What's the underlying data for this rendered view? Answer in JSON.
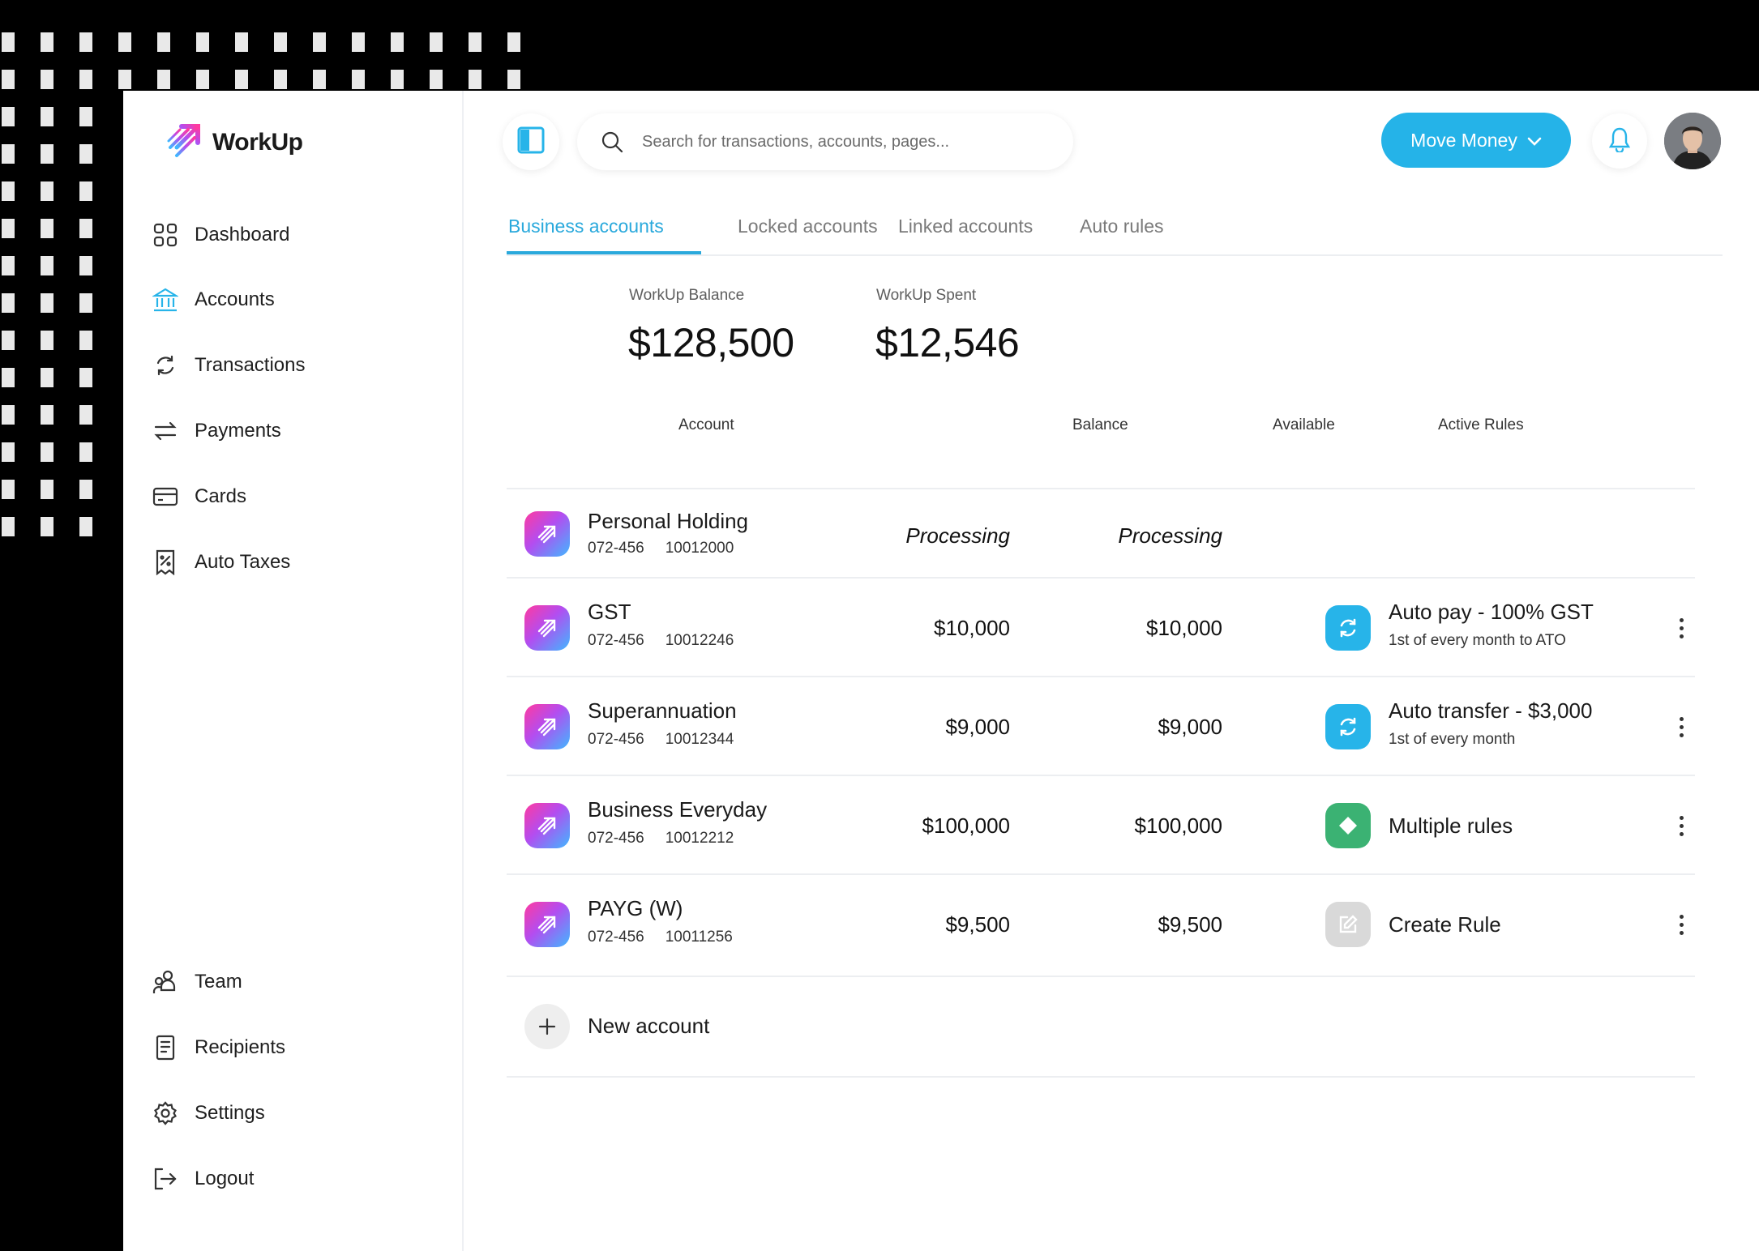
{
  "brand": {
    "name": "WorkUp"
  },
  "sidebar": {
    "items": [
      {
        "label": "Dashboard",
        "icon": "grid-icon"
      },
      {
        "label": "Accounts",
        "icon": "bank-icon",
        "active": true
      },
      {
        "label": "Transactions",
        "icon": "refresh-icon"
      },
      {
        "label": "Payments",
        "icon": "transfer-arrows-icon"
      },
      {
        "label": "Cards",
        "icon": "card-icon"
      },
      {
        "label": "Auto Taxes",
        "icon": "receipt-percent-icon"
      }
    ],
    "bottom_items": [
      {
        "label": "Team",
        "icon": "team-icon"
      },
      {
        "label": "Recipients",
        "icon": "document-list-icon"
      },
      {
        "label": "Settings",
        "icon": "gear-icon"
      },
      {
        "label": "Logout",
        "icon": "logout-icon"
      }
    ]
  },
  "header": {
    "search_placeholder": "Search for transactions, accounts, pages...",
    "move_money_label": "Move Money"
  },
  "tabs": [
    {
      "label": "Business accounts",
      "active": true
    },
    {
      "label": "Locked accounts"
    },
    {
      "label": "Linked accounts"
    },
    {
      "label": "Auto rules"
    }
  ],
  "summary": {
    "balance_label": "WorkUp Balance",
    "balance_value": "$128,500",
    "spent_label": "WorkUp Spent",
    "spent_value": "$12,546"
  },
  "table": {
    "columns": [
      "Account",
      "Balance",
      "Available",
      "Active Rules"
    ],
    "rows": [
      {
        "name": "Personal Holding",
        "bsb": "072-456",
        "number": "10012000",
        "balance": "Processing",
        "available": "Processing",
        "rule": null
      },
      {
        "name": "GST",
        "bsb": "072-456",
        "number": "10012246",
        "balance": "$10,000",
        "available": "$10,000",
        "rule": {
          "title": "Auto pay - 100% GST",
          "subtitle": "1st of every month to ATO",
          "icon": "refresh-icon",
          "color": "#27b4e9"
        }
      },
      {
        "name": "Superannuation",
        "bsb": "072-456",
        "number": "10012344",
        "balance": "$9,000",
        "available": "$9,000",
        "rule": {
          "title": "Auto transfer - $3,000",
          "subtitle": "1st of every month",
          "icon": "refresh-icon",
          "color": "#27b4e9"
        }
      },
      {
        "name": "Business Everyday",
        "bsb": "072-456",
        "number": "10012212",
        "balance": "$100,000",
        "available": "$100,000",
        "rule": {
          "title": "Multiple rules",
          "subtitle": "",
          "icon": "diamond-icon",
          "color": "#3bb273"
        }
      },
      {
        "name": "PAYG (W)",
        "bsb": "072-456",
        "number": "10011256",
        "balance": "$9,500",
        "available": "$9,500",
        "rule": {
          "title": "Create Rule",
          "subtitle": "",
          "icon": "edit-icon",
          "color": "#d9d9d9"
        }
      }
    ],
    "new_account_label": "New account"
  },
  "colors": {
    "accent": "#25b3e8",
    "green": "#3bb273"
  }
}
